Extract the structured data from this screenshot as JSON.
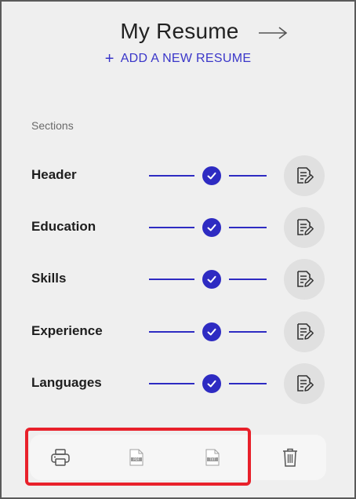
{
  "header": {
    "title": "My Resume",
    "add_label": "ADD A NEW RESUME"
  },
  "sections_label": "Sections",
  "sections": [
    {
      "label": "Header",
      "completed": true
    },
    {
      "label": "Education",
      "completed": true
    },
    {
      "label": "Skills",
      "completed": true
    },
    {
      "label": "Experience",
      "completed": true
    },
    {
      "label": "Languages",
      "completed": true
    }
  ],
  "toolbar": {
    "print_icon": "printer-icon",
    "pdf_icon": "pdf-file-icon",
    "pdf_tag": "PDF",
    "txt_icon": "txt-file-icon",
    "txt_tag": "TXT",
    "delete_icon": "trash-icon"
  },
  "colors": {
    "accent": "#2e2bc2",
    "link": "#3a36c9",
    "highlight": "#e8202a",
    "background": "#efefef"
  }
}
